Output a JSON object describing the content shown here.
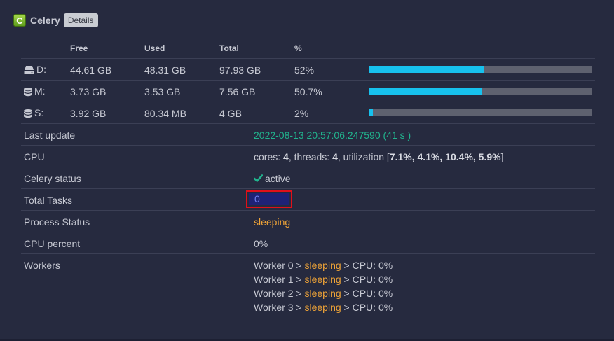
{
  "header": {
    "logo_letter": "C",
    "title": "Celery",
    "details_label": "Details"
  },
  "columns": {
    "free": "Free",
    "used": "Used",
    "total": "Total",
    "percent": "%"
  },
  "storage": [
    {
      "label": "D:",
      "icon": "hdd-icon",
      "free": "44.61 GB",
      "used": "48.31 GB",
      "total": "97.93 GB",
      "percent": "52%",
      "fill": 0.52
    },
    {
      "label": "M:",
      "icon": "database-icon",
      "free": "3.73 GB",
      "used": "3.53 GB",
      "total": "7.56 GB",
      "percent": "50.7%",
      "fill": 0.507
    },
    {
      "label": "S:",
      "icon": "database-icon",
      "free": "3.92 GB",
      "used": "80.34 MB",
      "total": "4 GB",
      "percent": "2%",
      "fill": 0.02
    }
  ],
  "info": {
    "last_update_label": "Last update",
    "last_update_value": "2022-08-13 20:57:06.247590 (41 s )",
    "cpu_label": "CPU",
    "cpu": {
      "cores_prefix": "cores: ",
      "cores": "4",
      "threads_prefix": ", threads: ",
      "threads": "4",
      "util_prefix": ", utilization [",
      "util": "7.1%, 4.1%, 10.4%, 5.9%",
      "util_suffix": "]"
    },
    "celery_status_label": "Celery status",
    "celery_status_value": "active",
    "total_tasks_label": "Total Tasks",
    "total_tasks_value": "0",
    "process_status_label": "Process Status",
    "process_status_value": "sleeping",
    "cpu_percent_label": "CPU percent",
    "cpu_percent_value": "0%",
    "workers_label": "Workers",
    "workers": [
      {
        "prefix": "Worker 0 > ",
        "state": "sleeping",
        "suffix": " > CPU: 0%"
      },
      {
        "prefix": "Worker 1 > ",
        "state": "sleeping",
        "suffix": " > CPU: 0%"
      },
      {
        "prefix": "Worker 2 > ",
        "state": "sleeping",
        "suffix": " > CPU: 0%"
      },
      {
        "prefix": "Worker 3 > ",
        "state": "sleeping",
        "suffix": " > CPU: 0%"
      }
    ]
  },
  "colors": {
    "background": "#262a3f",
    "accent": "#17c1ee",
    "status_green": "#21b38d",
    "status_orange": "#f0a437",
    "highlight_border": "#e0101a"
  }
}
